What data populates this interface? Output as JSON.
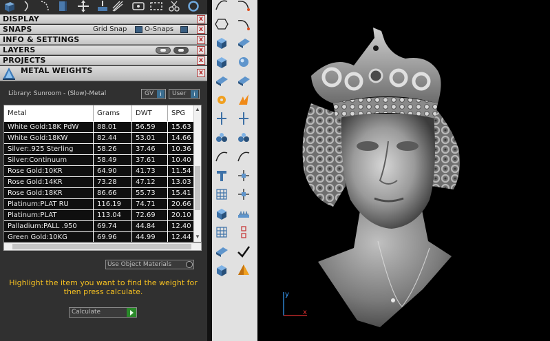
{
  "panel": {
    "sections": {
      "display": "DISPLAY",
      "snaps": "SNAPS",
      "info_settings": "INFO & SETTINGS",
      "layers": "LAYERS",
      "projects": "PROJECTS",
      "metal_weights": "METAL WEIGHTS"
    },
    "snaps": {
      "grid_snap": "Grid Snap",
      "o_snaps": "O-Snaps"
    },
    "close_glyph": "x"
  },
  "metal_weights": {
    "library_label": "Library: Sunroom - (Slow)-Metal",
    "gv_label": "GV",
    "user_label": "User",
    "columns": [
      "Metal",
      "Grams",
      "DWT",
      "SPG"
    ],
    "rows": [
      [
        "White Gold:18K PdW",
        "88.01",
        "56.59",
        "15.63"
      ],
      [
        "White Gold:18KW",
        "82.44",
        "53.01",
        "14.66"
      ],
      [
        "Silver:.925 Sterling",
        "58.26",
        "37.46",
        "10.36"
      ],
      [
        "Silver:Continuum",
        "58.49",
        "37.61",
        "10.40"
      ],
      [
        "Rose Gold:10KR",
        "64.90",
        "41.73",
        "11.54"
      ],
      [
        "Rose Gold:14KR",
        "73.28",
        "47.12",
        "13.03"
      ],
      [
        "Rose Gold:18KR",
        "86.66",
        "55.73",
        "15.41"
      ],
      [
        "Platinum:PLAT RU",
        "116.19",
        "74.71",
        "20.66"
      ],
      [
        "Platinum:PLAT",
        "113.04",
        "72.69",
        "20.10"
      ],
      [
        "Palladium:PALL .950",
        "69.74",
        "44.84",
        "12.40"
      ],
      [
        "Green Gold:10KG",
        "69.96",
        "44.99",
        "12.44"
      ]
    ],
    "use_object_materials": "Use Object Materials",
    "instruction": "Highlight the item you want to find the weight for then press calculate.",
    "calculate": "Calculate"
  },
  "viewport": {
    "axis_y": "y",
    "axis_x": "x",
    "axis_y_color": "#3aa0ff",
    "axis_x_color": "#e03030"
  },
  "colors": {
    "panel_bg": "#303030",
    "section_bar": "#d0d0d0",
    "instruction_text": "#f5c021",
    "toolbar_bg": "#e1e1e1"
  },
  "toolbar_icons": [
    "curve-tool-icon",
    "arc-tool-icon",
    "polygon-icon",
    "arc-3pt-icon",
    "offset-points-icon",
    "revolve-icon",
    "box-solid-icon",
    "boolean-icon",
    "cylinder-icon",
    "surface-icon",
    "gear-tool-icon",
    "fire-render-icon",
    "split-icon",
    "extend-icon",
    "spheres-icon",
    "connect-points-icon",
    "rebuild-curve-icon",
    "rotate-copy-icon",
    "text-tool-icon",
    "move-icon",
    "array-icon",
    "project-icon",
    "cube-icon",
    "pipes-icon",
    "grid-array-icon",
    "chain-icon",
    "cylinder-slice-icon",
    "checkmark-icon",
    "cone-icon",
    "pyramid-icon"
  ]
}
